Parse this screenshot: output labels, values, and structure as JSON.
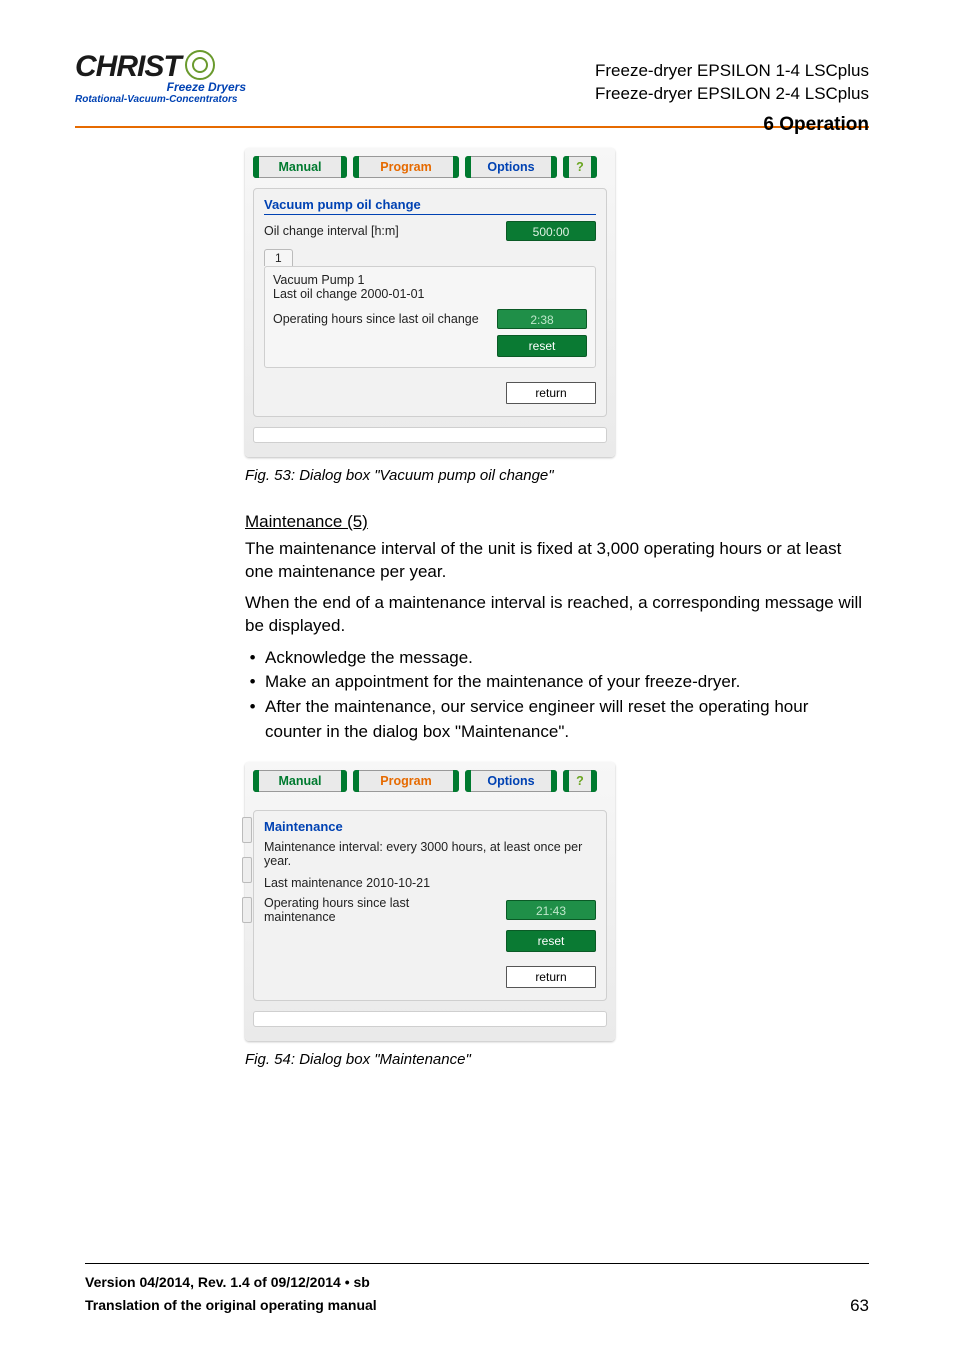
{
  "header": {
    "product_line_1": "Freeze-dryer EPSILON 1-4 LSCplus",
    "product_line_2": "Freeze-dryer EPSILON 2-4 LSCplus",
    "section_title": "6 Operation"
  },
  "logo": {
    "brand": "CHRIST",
    "sub1": "Freeze Dryers",
    "sub2": "Rotational-Vacuum-Concentrators"
  },
  "dialog1": {
    "tabs": {
      "manual": "Manual",
      "program": "Program",
      "options": "Options",
      "help": "?"
    },
    "title": "Vacuum pump oil change",
    "interval_label": "Oil change interval [h:m]",
    "interval_value": "500:00",
    "pump_tab": "1",
    "pump_name": "Vacuum Pump 1",
    "last_oil_change_label": "Last oil change 2000-01-01",
    "op_hours_label": "Operating hours since last oil change",
    "op_hours_value": "2:38",
    "reset": "reset",
    "return": "return"
  },
  "caption1": "Fig. 53: Dialog box \"Vacuum pump oil change\"",
  "maintenance": {
    "heading": "Maintenance (5)",
    "p1": "The maintenance interval of the unit is fixed at 3,000 operating hours or at least one maintenance per year.",
    "p2": "When the end of a maintenance interval is reached, a corresponding message will be displayed.",
    "b1": "Acknowledge the message.",
    "b2": "Make an appointment for the maintenance of your freeze-dryer.",
    "b3": "After the maintenance, our service engineer will reset the operating hour counter in the dialog box \"Maintenance\"."
  },
  "dialog2": {
    "tabs": {
      "manual": "Manual",
      "program": "Program",
      "options": "Options",
      "help": "?"
    },
    "title": "Maintenance",
    "interval_text": "Maintenance interval: every 3000 hours, at least once per year.",
    "last_maint": "Last maintenance 2010-10-21",
    "op_hours_label": "Operating hours since last maintenance",
    "op_hours_value": "21:43",
    "reset": "reset",
    "return": "return"
  },
  "caption2": "Fig. 54: Dialog box \"Maintenance\"",
  "footer": {
    "l1": "Version 04/2014, Rev. 1.4 of 09/12/2014 • sb",
    "l2": "Translation of the original operating manual",
    "page": "63"
  }
}
